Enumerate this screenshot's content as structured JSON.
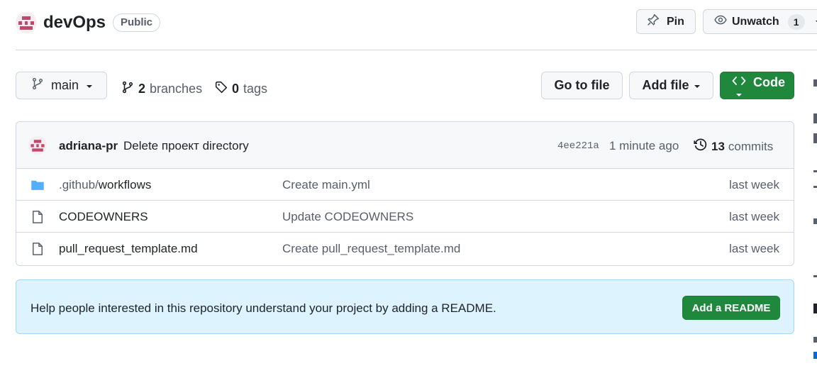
{
  "header": {
    "repo_name": "devOps",
    "visibility": "Public",
    "pin_label": "Pin",
    "unwatch_label": "Unwatch",
    "watch_count": "1"
  },
  "branch_bar": {
    "branch": "main",
    "branch_count": "2",
    "branches_label": "branches",
    "tag_count": "0",
    "tags_label": "tags",
    "go_to_file": "Go to file",
    "add_file": "Add file",
    "code": "Code"
  },
  "latest_commit": {
    "author": "adriana-pr",
    "message": "Delete проект directory",
    "sha": "4ee221a",
    "time": "1 minute ago",
    "commit_count": "13",
    "commits_label": "commits"
  },
  "files": [
    {
      "type": "folder",
      "name_prefix": ".github/",
      "name": "workflows",
      "commit": "Create main.yml",
      "time": "last week"
    },
    {
      "type": "file",
      "name_prefix": "",
      "name": "CODEOWNERS",
      "commit": "Update CODEOWNERS",
      "time": "last week"
    },
    {
      "type": "file",
      "name_prefix": "",
      "name": "pull_request_template.md",
      "commit": "Create pull_request_template.md",
      "time": "last week"
    }
  ],
  "readme_banner": {
    "text": "Help people interested in this repository understand your project by adding a README.",
    "button": "Add a README"
  },
  "colors": {
    "primary_green": "#1f883d",
    "folder_blue": "#54aeff",
    "banner_bg": "#ddf4ff"
  },
  "icons": [
    "identicon-avatar",
    "pin-icon",
    "eye-icon",
    "caret-down-icon",
    "git-branch-icon",
    "tag-icon",
    "code-icon",
    "history-icon",
    "folder-icon",
    "file-icon"
  ]
}
